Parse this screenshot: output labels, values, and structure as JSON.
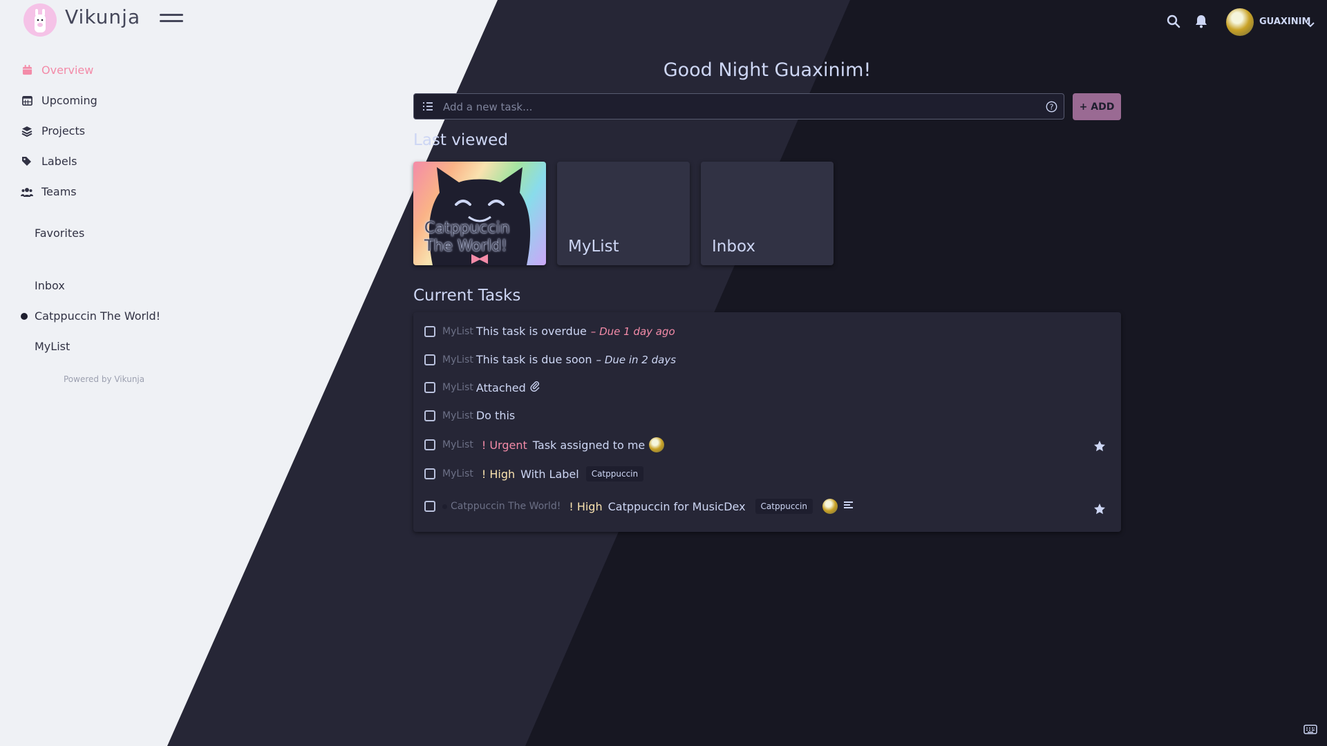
{
  "colors": {
    "sidebar_bg": "#eff1f5",
    "main_bg": "#1e1e2e",
    "accent": "#f38ba8",
    "urgent": "#f38ba8",
    "high": "#f9e2af",
    "add_button": "#9a6a93"
  },
  "app": {
    "name": "Vikunja"
  },
  "sidebar": {
    "nav": [
      {
        "label": "Overview",
        "icon": "calendar-icon",
        "active": true
      },
      {
        "label": "Upcoming",
        "icon": "calendar-grid-icon"
      },
      {
        "label": "Projects",
        "icon": "layers-icon"
      },
      {
        "label": "Labels",
        "icon": "tags-icon"
      },
      {
        "label": "Teams",
        "icon": "users-icon"
      }
    ],
    "favorites_label": "Favorites",
    "projects": [
      {
        "label": "Inbox"
      },
      {
        "label": "Catppuccin The World!"
      },
      {
        "label": "MyList"
      }
    ],
    "powered_by": "Powered by Vikunja"
  },
  "topbar": {
    "username": "GUAXINIM",
    "icons": [
      "search-icon",
      "bell-icon",
      "chevron-down-icon"
    ]
  },
  "main": {
    "greeting": "Good Night Guaxinim!",
    "add_task_placeholder": "Add a new task...",
    "add_button": "+ ADD",
    "last_viewed_title": "Last viewed",
    "last_viewed": [
      {
        "title": "Catppuccin The World!"
      },
      {
        "title": "MyList"
      },
      {
        "title": "Inbox"
      }
    ],
    "current_tasks_title": "Current Tasks",
    "tasks": [
      {
        "project": "MyList",
        "title": "This task is overdue",
        "due": "– Due 1 day ago"
      },
      {
        "project": "MyList",
        "title": "This task is due soon",
        "due": "– Due in 2 days"
      },
      {
        "project": "MyList",
        "title": "Attached",
        "icons": [
          "paperclip-icon"
        ]
      },
      {
        "project": "MyList",
        "title": "Do this"
      },
      {
        "project": "MyList",
        "priority": "! Urgent",
        "title": "Task assigned to me",
        "favorite": true
      },
      {
        "project": "MyList",
        "priority": "! High",
        "title": "With Label",
        "label": "Catppuccin"
      },
      {
        "project": "Catppuccin The World!",
        "priority": "! High",
        "title": "Catppuccin for MusicDex",
        "label": "Catppuccin",
        "favorite": true,
        "icons": [
          "description-icon"
        ]
      }
    ]
  }
}
